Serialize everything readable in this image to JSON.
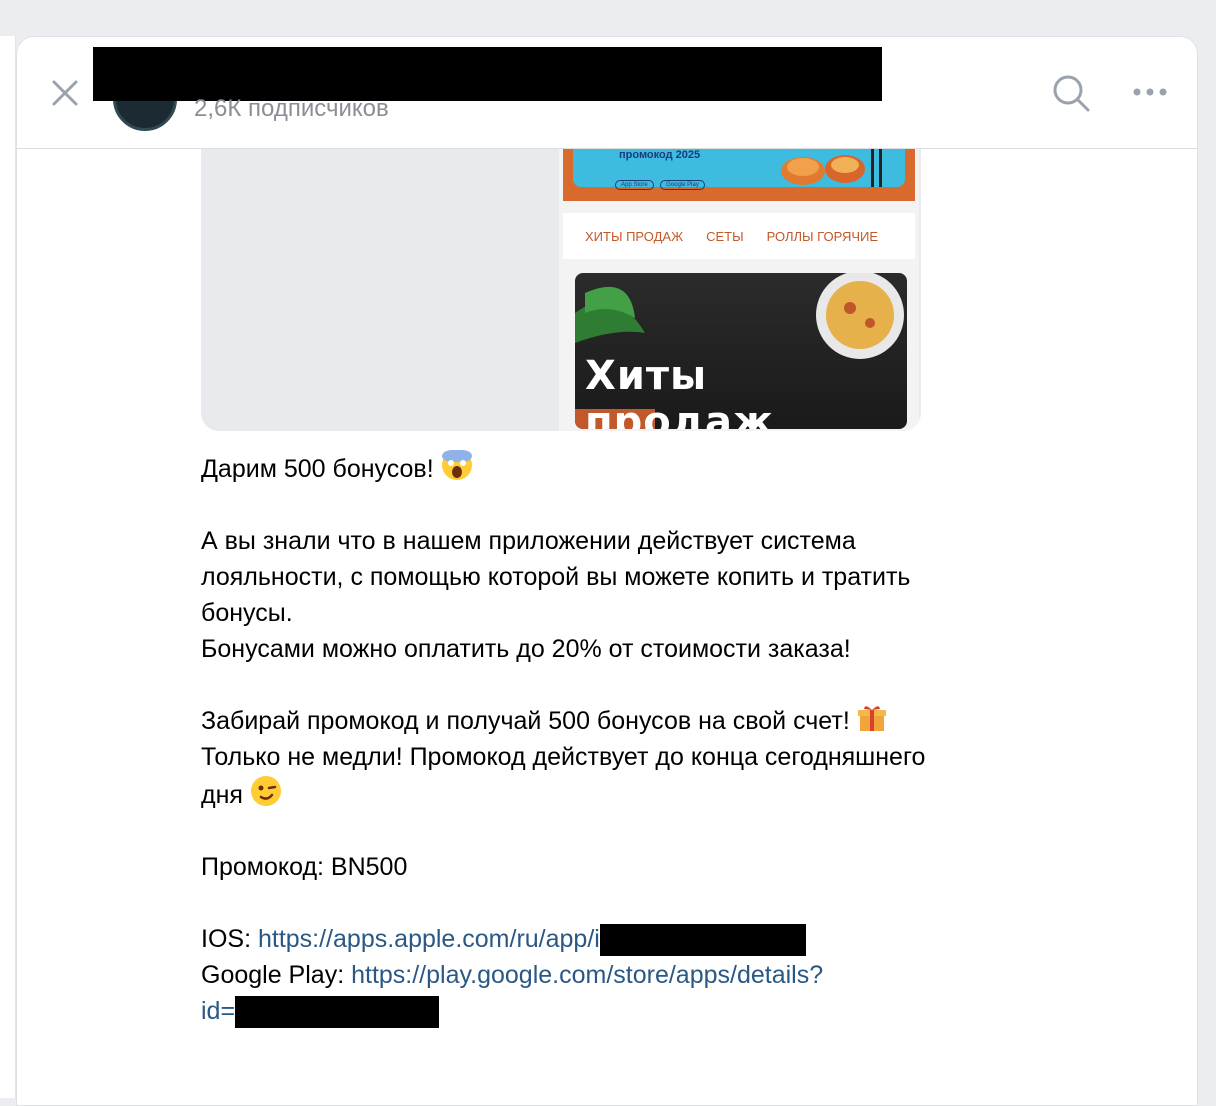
{
  "header": {
    "subscribers": "2,6К подписчиков",
    "close_icon": "close-icon",
    "search_icon": "search-icon",
    "more_icon": "more-dots-icon"
  },
  "media": {
    "promo_text": "промокод 2025",
    "badge_appstore": "App Store",
    "badge_googleplay": "Google Play",
    "categories": [
      "ХИТЫ ПРОДАЖ",
      "СЕТЫ",
      "РОЛЛЫ ГОРЯЧИЕ"
    ],
    "hits_title": "Хиты продаж"
  },
  "post": {
    "line1": "Дарим 500 бонусов!",
    "para2_line1": "А вы знали что в нашем приложении действует система",
    "para2_line2": "лояльности, с помощью которой вы можете копить и тратить",
    "para2_line3": "бонусы.",
    "para2_line4": "Бонусами можно оплатить до 20% от стоимости заказа!",
    "para3_line1": "Забирай промокод и получай 500 бонусов на свой счет!",
    "para3_line2": "Только не медли! Промокод действует до конца сегодняшнего",
    "para3_line3": "дня",
    "promo": "Промокод: BN500",
    "ios_label": "IOS: ",
    "ios_link": "https://apps.apple.com/ru/app/i",
    "gp_label": "Google Play: ",
    "gp_link": "https://play.google.com/store/apps/details?",
    "gp_link2": "id="
  },
  "colors": {
    "link": "#2a5885",
    "accent_orange": "#d86a2d",
    "category_text": "#c2592a"
  }
}
